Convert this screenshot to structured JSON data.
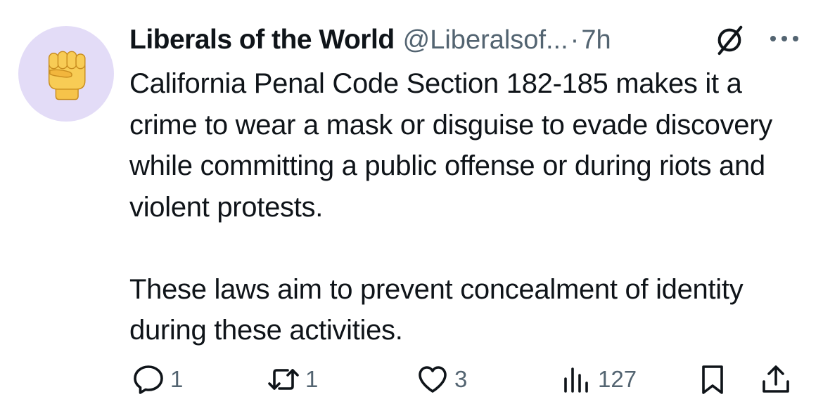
{
  "tweet": {
    "author": {
      "display_name": "Liberals of the World",
      "handle": "@Liberalsof...",
      "avatar_icon": "raised-fist-emoji"
    },
    "separator": "·",
    "time": "7h",
    "body": {
      "paragraph_1": "California Penal Code Section 182-185 makes it a crime to wear a mask or disguise to evade discovery while committing a public offense or during riots and violent protests.",
      "paragraph_2": "These laws aim to prevent concealment of identity during these activities."
    },
    "actions": {
      "reply_count": "1",
      "retweet_count": "1",
      "like_count": "3",
      "views_count": "127"
    }
  },
  "colors": {
    "text_primary": "#0f1419",
    "text_secondary": "#536471",
    "avatar_background": "#e3dcf7",
    "fist": "#f6c34a"
  }
}
